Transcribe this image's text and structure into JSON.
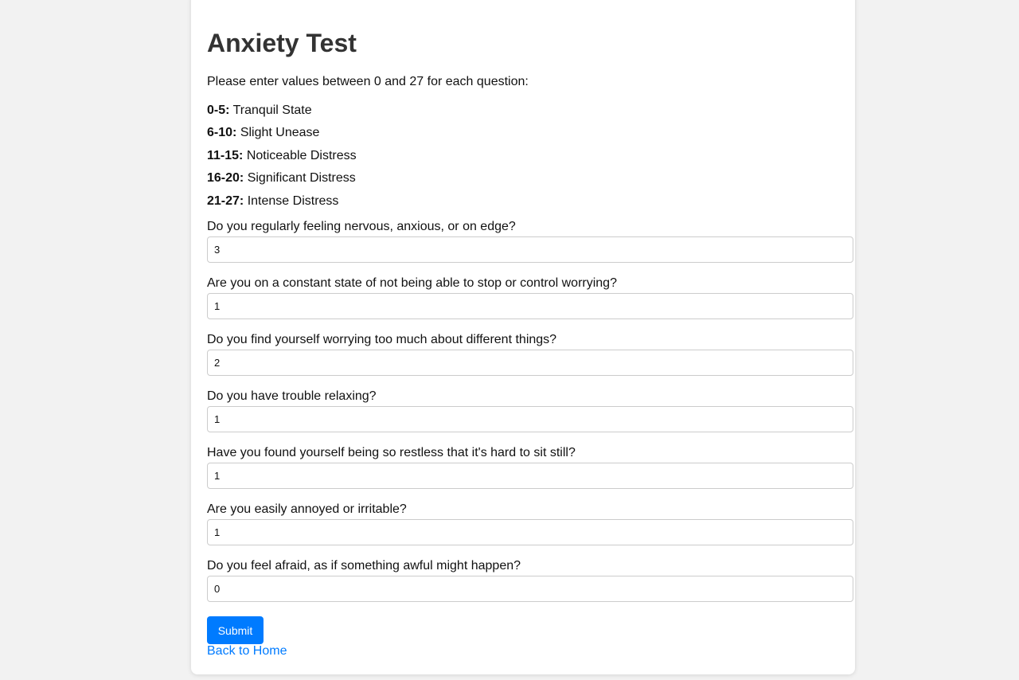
{
  "page": {
    "title": "Anxiety Test",
    "intro": "Please enter values between 0 and 27 for each question:"
  },
  "legend": [
    {
      "range": "0-5:",
      "text": "Tranquil State"
    },
    {
      "range": "6-10:",
      "text": "Slight Unease"
    },
    {
      "range": "11-15:",
      "text": "Noticeable Distress"
    },
    {
      "range": "16-20:",
      "text": "Significant Distress"
    },
    {
      "range": "21-27:",
      "text": "Intense Distress"
    }
  ],
  "questions": [
    {
      "label": "Do you regularly feeling nervous, anxious, or on edge?",
      "value": "3"
    },
    {
      "label": "Are you on a constant state of not being able to stop or control worrying?",
      "value": "1"
    },
    {
      "label": "Do you find yourself worrying too much about different things?",
      "value": "2"
    },
    {
      "label": "Do you have trouble relaxing?",
      "value": "1"
    },
    {
      "label": "Have you found yourself being so restless that it's hard to sit still?",
      "value": "1"
    },
    {
      "label": "Are you easily annoyed or irritable?",
      "value": "1"
    },
    {
      "label": "Do you feel afraid, as if something awful might happen?",
      "value": "0"
    }
  ],
  "actions": {
    "submit_label": "Submit",
    "back_label": "Back to Home"
  },
  "colors": {
    "accent": "#007bff",
    "background": "#f2f2f2",
    "card": "#ffffff"
  }
}
